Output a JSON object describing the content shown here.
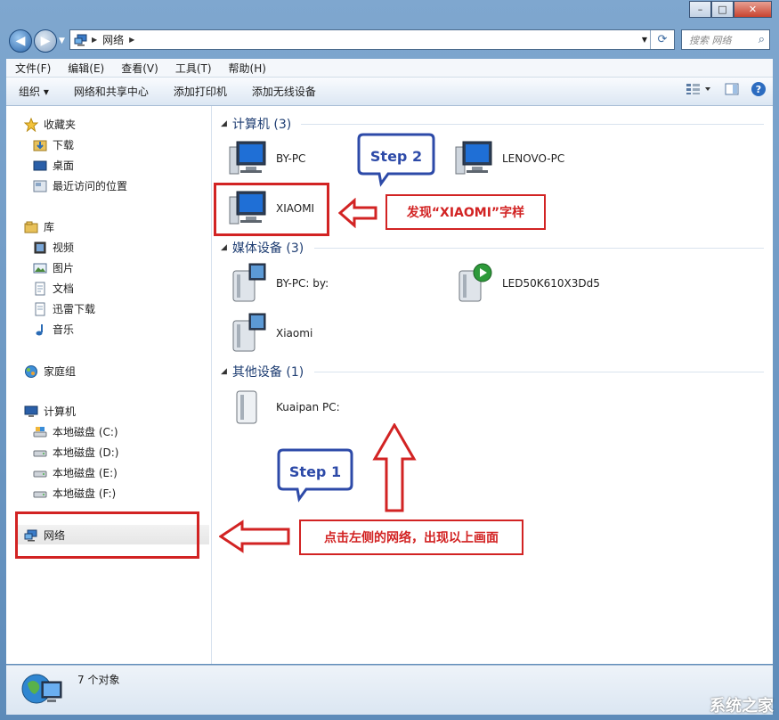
{
  "window": {
    "breadcrumb": "网络",
    "search_placeholder": "搜索 网络",
    "min": "–",
    "max": "□",
    "close": "✕"
  },
  "menu": [
    "文件(F)",
    "编辑(E)",
    "查看(V)",
    "工具(T)",
    "帮助(H)"
  ],
  "toolbar": {
    "organize": "组织 ▾",
    "network_center": "网络和共享中心",
    "add_printer": "添加打印机",
    "add_wireless": "添加无线设备"
  },
  "sidebar": {
    "favorites": "收藏夹",
    "downloads": "下载",
    "desktop": "桌面",
    "recent": "最近访问的位置",
    "libraries": "库",
    "videos": "视频",
    "pictures": "图片",
    "documents": "文档",
    "xunlei": "迅雷下载",
    "music": "音乐",
    "homegroup": "家庭组",
    "computer": "计算机",
    "disk_c": "本地磁盘 (C:)",
    "disk_d": "本地磁盘 (D:)",
    "disk_e": "本地磁盘 (E:)",
    "disk_f": "本地磁盘 (F:)",
    "network": "网络"
  },
  "groups": {
    "computers": "计算机 (3)",
    "media": "媒体设备 (3)",
    "other": "其他设备 (1)"
  },
  "items": {
    "by_pc": "BY-PC",
    "lenovo_pc": "LENOVO-PC",
    "xiaomi_pc": "XIAOMI",
    "by_pc_media": "BY-PC: by:",
    "led_tv": "LED50K610X3Dd5",
    "xiaomi_media": "Xiaomi",
    "kuaipan": "Kuaipan PC:"
  },
  "status": {
    "count": "7 个对象"
  },
  "annotations": {
    "step1": "Step 1",
    "step2": "Step 2",
    "found_label": "发现“XIAOMI”字样",
    "click_label": "点击左侧的网络，出现以上画面"
  },
  "watermark": "系统之家",
  "colors": {
    "annotation_red": "#d22323",
    "bubble_blue": "#2d4aa8",
    "group_blue": "#1e3d72"
  }
}
